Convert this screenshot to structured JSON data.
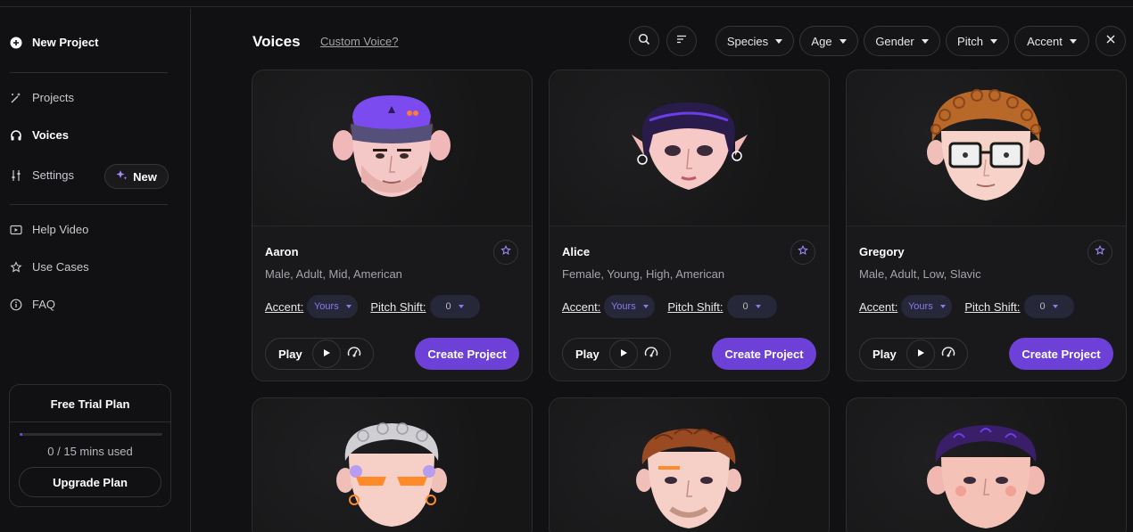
{
  "sidebar": {
    "new_project": "New Project",
    "items": [
      {
        "label": "Projects",
        "icon": "magic-wand-icon"
      },
      {
        "label": "Voices",
        "icon": "headphones-icon"
      },
      {
        "label": "Settings",
        "icon": "sliders-icon"
      },
      {
        "label": "Help Video",
        "icon": "video-icon"
      },
      {
        "label": "Use Cases",
        "icon": "star-icon"
      },
      {
        "label": "FAQ",
        "icon": "info-icon"
      }
    ],
    "new_badge": "New",
    "plan": {
      "title": "Free Trial Plan",
      "used": "0 / 15 mins used",
      "progress_fraction": 0.02,
      "upgrade": "Upgrade Plan"
    }
  },
  "header": {
    "title": "Voices",
    "custom_link": "Custom Voice?",
    "filters": [
      "Species",
      "Age",
      "Gender",
      "Pitch",
      "Accent"
    ]
  },
  "labels": {
    "accent": "Accent:",
    "pitch_shift": "Pitch Shift:",
    "play": "Play",
    "create": "Create Project"
  },
  "voices": [
    {
      "name": "Aaron",
      "desc": "Male, Adult, Mid, American",
      "accent": "Yours",
      "pitch": "0"
    },
    {
      "name": "Alice",
      "desc": "Female, Young, High, American",
      "accent": "Yours",
      "pitch": "0"
    },
    {
      "name": "Gregory",
      "desc": "Male, Adult, Low, Slavic",
      "accent": "Yours",
      "pitch": "0"
    }
  ],
  "colors": {
    "accent": "#6d40d8",
    "background": "#111113",
    "card": "#19191c"
  }
}
